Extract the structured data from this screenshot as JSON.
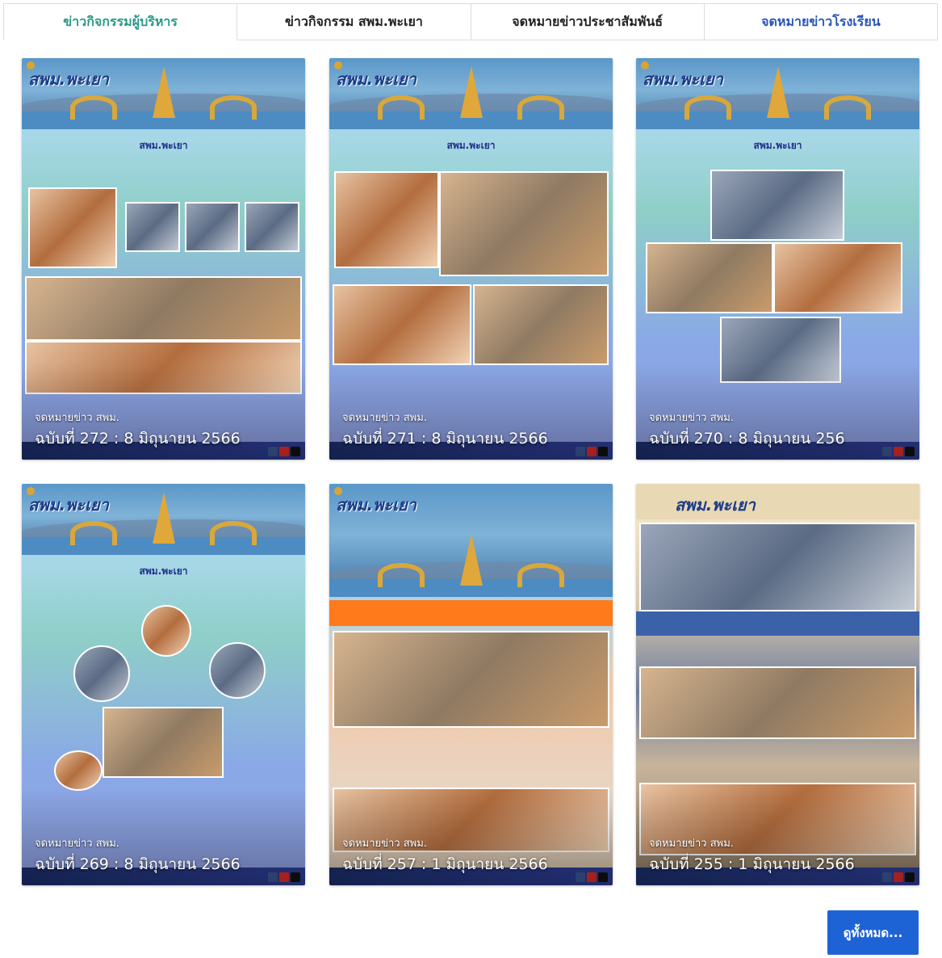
{
  "tabs": [
    {
      "label": "ข่าวกิจกรรมผู้บริหาร",
      "active": true
    },
    {
      "label": "ข่าวกิจกรรม สพม.พะเยา",
      "active": false
    },
    {
      "label": "จดหมายข่าวประชาสัมพันธ์",
      "active": false
    },
    {
      "label": "จดหมายข่าวโรงเรียน",
      "active": false
    }
  ],
  "cards": [
    {
      "label": "จดหมายข่าว สพม.",
      "title": "ฉบับที่ 272 : 8 มิถุนายน 2566",
      "poster_logo": "สพม.พะเยา",
      "poster_headline": "สพม.พะเยา"
    },
    {
      "label": "จดหมายข่าว สพม.",
      "title": "ฉบับที่ 271 : 8 มิถุนายน 2566",
      "poster_logo": "สพม.พะเยา",
      "poster_headline": "สพม.พะเยา"
    },
    {
      "label": "จดหมายข่าว สพม.",
      "title": "ฉบับที่ 270 : 8 มิถุนายน 256",
      "poster_logo": "สพม.พะเยา",
      "poster_headline": "สพม.พะเยา"
    },
    {
      "label": "จดหมายข่าว สพม.",
      "title": "ฉบับที่ 269 : 8 มิถุนายน 2566",
      "poster_logo": "สพม.พะเยา",
      "poster_headline": "สพม.พะเยา"
    },
    {
      "label": "จดหมายข่าว สพม.",
      "title": "ฉบับที่ 257 : 1 มิถุนายน 2566",
      "poster_logo": "สพม.พะเยา",
      "poster_headline": ""
    },
    {
      "label": "จดหมายข่าว สพม.",
      "title": "ฉบับที่ 255 : 1 มิถุนายน 2566",
      "poster_logo": "สพม.พะเยา",
      "poster_headline": ""
    }
  ],
  "view_all_label": "ดูทั้งหมด...",
  "colors": {
    "active_tab": "#2b9a8a",
    "school_tab": "#2a56b8",
    "button": "#1e63d6"
  }
}
